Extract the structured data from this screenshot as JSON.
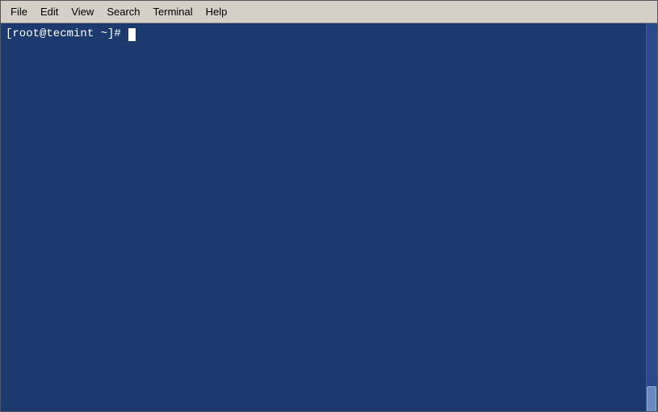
{
  "menubar": {
    "items": [
      {
        "label": "File",
        "id": "file"
      },
      {
        "label": "Edit",
        "id": "edit"
      },
      {
        "label": "View",
        "id": "view"
      },
      {
        "label": "Search",
        "id": "search"
      },
      {
        "label": "Terminal",
        "id": "terminal"
      },
      {
        "label": "Help",
        "id": "help"
      }
    ]
  },
  "terminal": {
    "prompt": "[root@tecmint ~]# "
  }
}
